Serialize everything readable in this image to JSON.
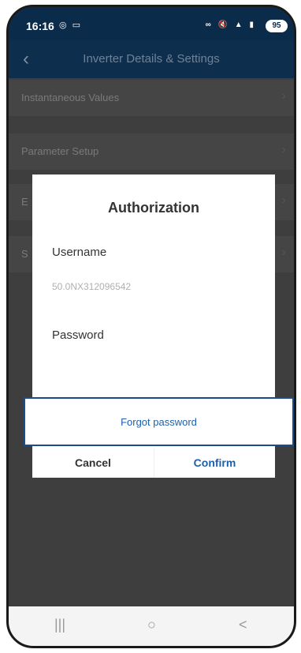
{
  "status_bar": {
    "time": "16:16",
    "left_icons": "◎ ▭",
    "right_icons": "∞ 🔇 ▲ ▮",
    "battery": "95"
  },
  "app_bar": {
    "back_icon": "chevron-left-icon",
    "title": "Inverter Details & Settings"
  },
  "menu": {
    "items": [
      {
        "label": "Instantaneous Values"
      },
      {
        "label": "Parameter Setup"
      },
      {
        "label": "E"
      },
      {
        "label": "S"
      }
    ]
  },
  "dialog": {
    "title": "Authorization",
    "username_label": "Username",
    "username_value": "50.0NX312096542",
    "password_label": "Password",
    "password_value": "",
    "forgot_password": "Forgot password",
    "cancel_label": "Cancel",
    "confirm_label": "Confirm"
  },
  "nav_bar": {
    "recent": "|||",
    "home": "○",
    "back": "<"
  },
  "colors": {
    "accent": "#1d5fa8",
    "header": "#0e2e4e",
    "highlight_border": "#1e4b8a"
  }
}
